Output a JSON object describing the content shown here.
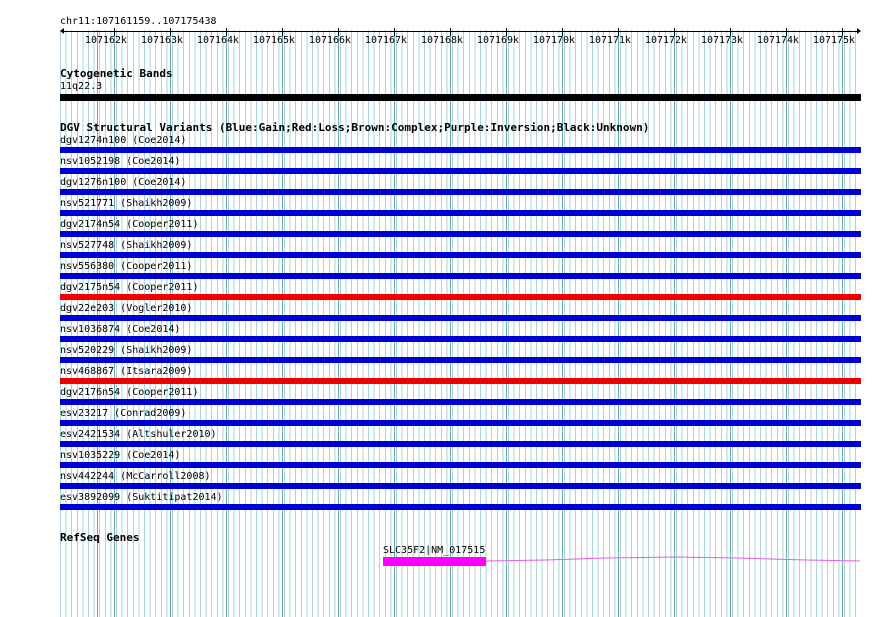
{
  "ruler": {
    "location": "chr11:107161159..107175438",
    "ticks": [
      "107162k",
      "107163k",
      "107164k",
      "107165k",
      "107166k",
      "107167k",
      "107168k",
      "107169k",
      "107170k",
      "107171k",
      "107172k",
      "107173k",
      "107174k",
      "107175k"
    ]
  },
  "cytoband": {
    "title": "Cytogenetic Bands",
    "band_label": "11q22.3",
    "band_color": "#000000"
  },
  "dgv": {
    "title": "DGV Structural Variants (Blue:Gain;Red:Loss;Brown:Complex;Purple:Inversion;Black:Unknown)",
    "colors": {
      "gain": "#0000d0",
      "loss": "#ee0000"
    },
    "variants": [
      {
        "label": "dgv1274n100 (Coe2014)",
        "type": "gain"
      },
      {
        "label": "nsv1052198 (Coe2014)",
        "type": "gain"
      },
      {
        "label": "dgv1276n100 (Coe2014)",
        "type": "gain"
      },
      {
        "label": "nsv521771 (Shaikh2009)",
        "type": "gain"
      },
      {
        "label": "dgv2174n54 (Cooper2011)",
        "type": "gain"
      },
      {
        "label": "nsv527748 (Shaikh2009)",
        "type": "gain"
      },
      {
        "label": "nsv556380 (Cooper2011)",
        "type": "gain"
      },
      {
        "label": "dgv2175n54 (Cooper2011)",
        "type": "loss"
      },
      {
        "label": "dgv22e203 (Vogler2010)",
        "type": "gain"
      },
      {
        "label": "nsv1036874 (Coe2014)",
        "type": "gain"
      },
      {
        "label": "nsv520229 (Shaikh2009)",
        "type": "gain"
      },
      {
        "label": "nsv468867 (Itsara2009)",
        "type": "loss"
      },
      {
        "label": "dgv2176n54 (Cooper2011)",
        "type": "gain"
      },
      {
        "label": "esv23217 (Conrad2009)",
        "type": "gain"
      },
      {
        "label": "esv2421534 (Altshuler2010)",
        "type": "gain"
      },
      {
        "label": "nsv1035229 (Coe2014)",
        "type": "gain"
      },
      {
        "label": "nsv442244 (McCarroll2008)",
        "type": "gain"
      },
      {
        "label": "esv3892099 (Suktitipat2014)",
        "type": "gain"
      }
    ]
  },
  "refseq": {
    "title": "RefSeq Genes",
    "gene_label": "SLC35F2|NM_017515",
    "gene_color": "#ff00ff"
  }
}
